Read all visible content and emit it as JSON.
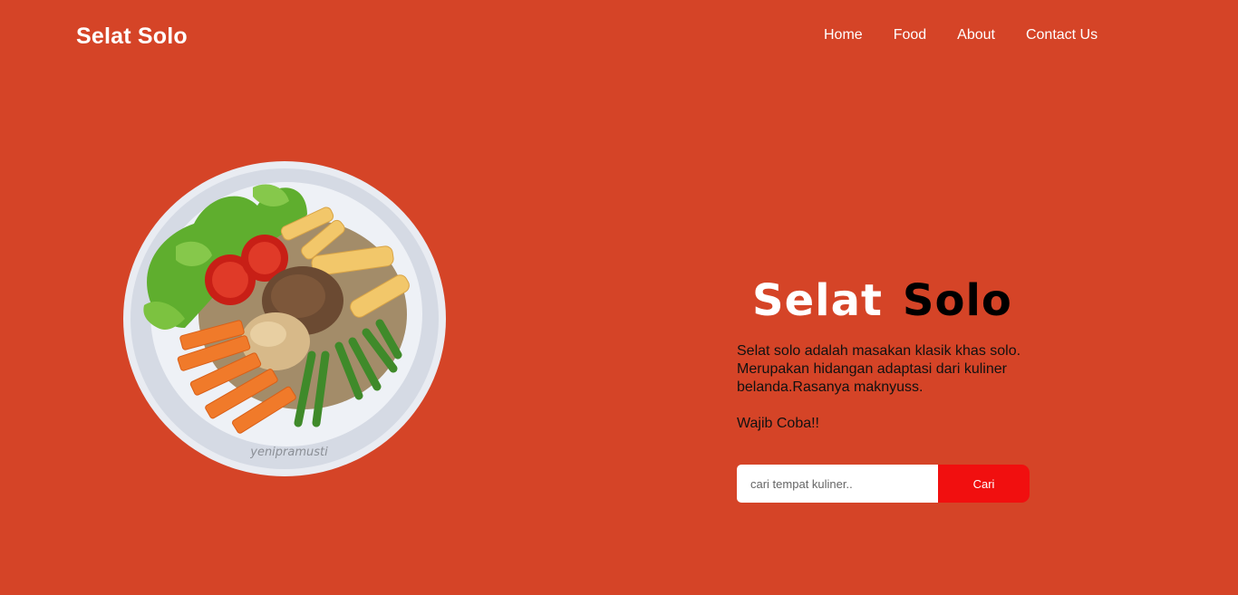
{
  "navbar": {
    "brand": "Selat Solo",
    "links": [
      {
        "label": "Home"
      },
      {
        "label": "Food"
      },
      {
        "label": "About"
      },
      {
        "label": "Contact Us"
      }
    ]
  },
  "hero": {
    "image": {
      "watermark": "yenipramusti"
    },
    "title_word1": "Selat",
    "title_word2": "Solo",
    "description": "Selat solo adalah masakan klasik khas solo. Merupakan hidangan adaptasi dari kuliner belanda.Rasanya maknyuss.",
    "cta": "Wajib Coba!!"
  },
  "search": {
    "placeholder": "cari tempat kuliner..",
    "button_label": "Cari"
  },
  "colors": {
    "background": "#d54427",
    "button": "#f10f0f"
  }
}
